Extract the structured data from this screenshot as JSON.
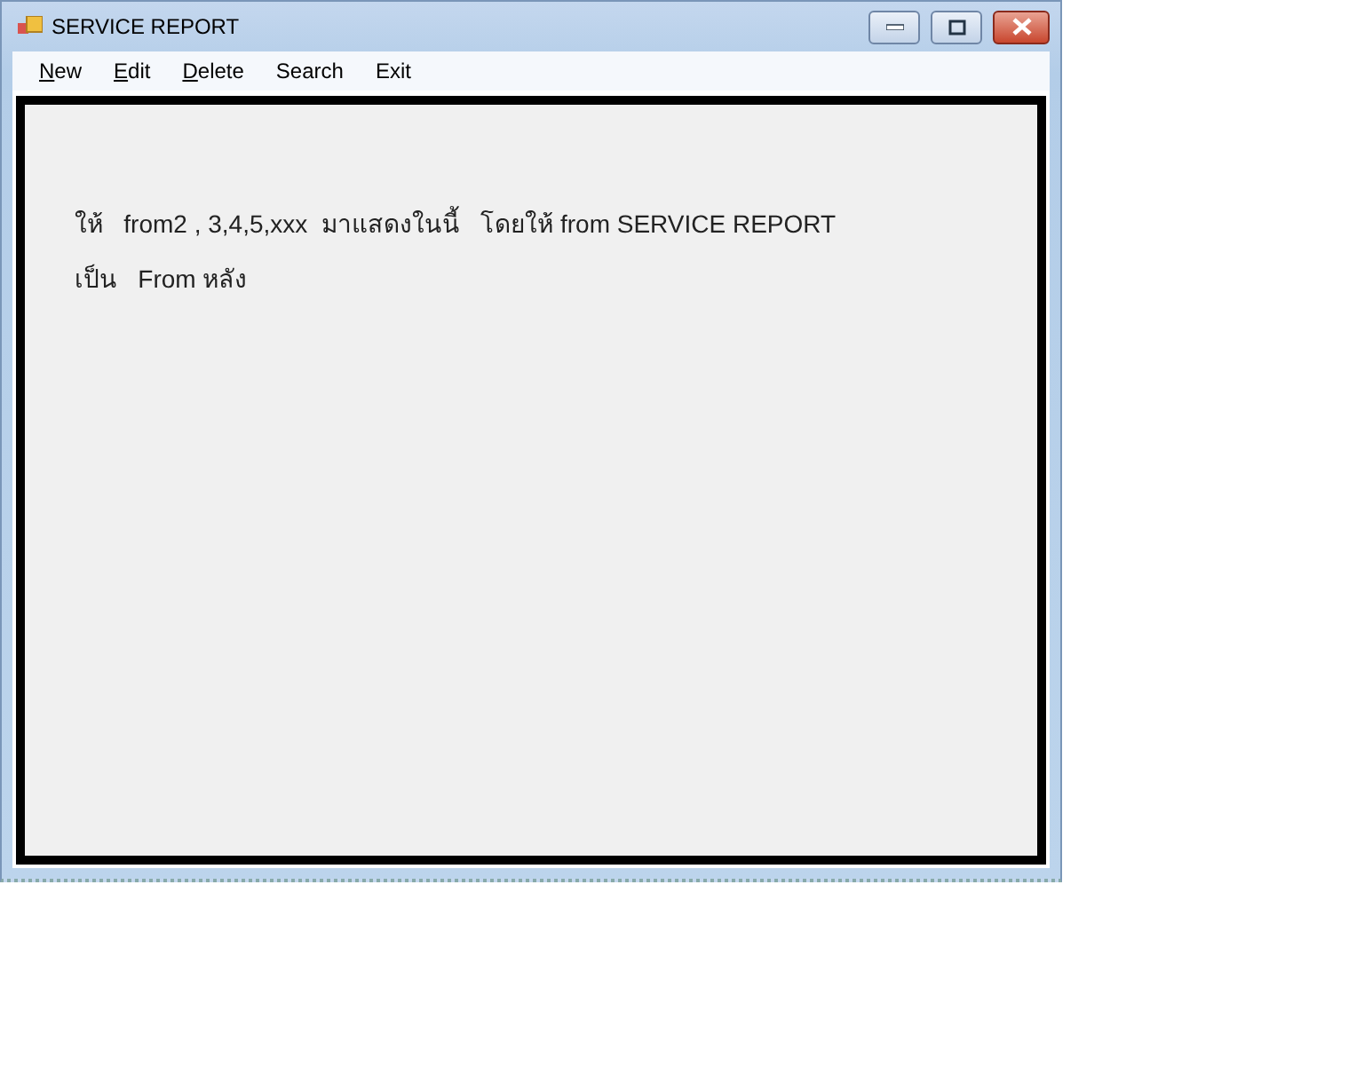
{
  "window": {
    "title": "SERVICE REPORT"
  },
  "menu": [
    {
      "label": "New",
      "mnemonic": true
    },
    {
      "label": "Edit",
      "mnemonic": true
    },
    {
      "label": "Delete",
      "mnemonic": true
    },
    {
      "label": "Search",
      "mnemonic": false
    },
    {
      "label": "Exit",
      "mnemonic": false
    }
  ],
  "content": {
    "lines": [
      "ให้   from2 , 3,4,5,xxx  มาแสดงในนี้   โดยให้ from SERVICE REPORT",
      "เป็น   From หลัง"
    ]
  }
}
